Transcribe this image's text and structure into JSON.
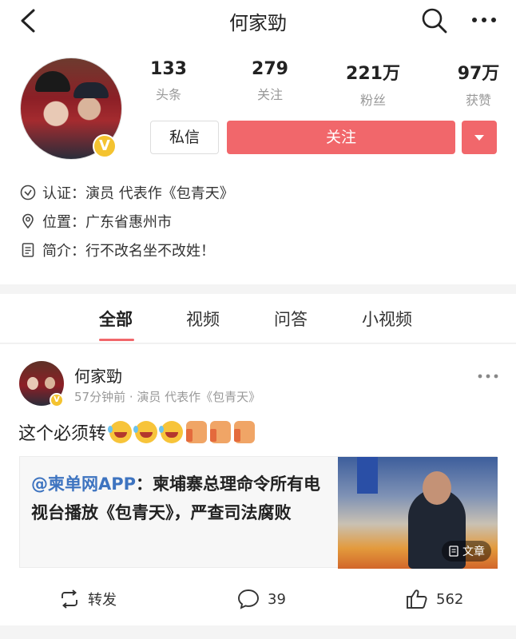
{
  "topbar": {
    "title": "何家勁"
  },
  "profile": {
    "stats": [
      {
        "value": "133",
        "label": "头条"
      },
      {
        "value": "279",
        "label": "关注"
      },
      {
        "value": "221万",
        "label": "粉丝"
      },
      {
        "value": "97万",
        "label": "获赞"
      }
    ],
    "message_label": "私信",
    "follow_label": "关注",
    "info": [
      {
        "icon": "verified-icon",
        "label": "认证：",
        "value": "演员 代表作《包青天》"
      },
      {
        "icon": "location-icon",
        "label": "位置：",
        "value": "广东省惠州市"
      },
      {
        "icon": "document-icon",
        "label": "简介：",
        "value": "行不改名坐不改姓！"
      }
    ]
  },
  "tabs": [
    "全部",
    "视频",
    "问答",
    "小视频"
  ],
  "post": {
    "author": "何家勁",
    "meta": "57分钟前 · 演员 代表作《包青天》",
    "text": "这个必须转",
    "emojis": [
      "laugh",
      "laugh",
      "laugh",
      "thumbs-up",
      "thumbs-up",
      "thumbs-up"
    ],
    "shared": {
      "source": "@柬单网APP",
      "colon": "：",
      "title": "柬埔寨总理命令所有电视台播放《包青天》，严查司法腐败",
      "badge": "文章"
    },
    "actions": {
      "repost_label": "转发",
      "comments": "39",
      "likes": "562"
    }
  },
  "colors": {
    "accent": "#f1676b",
    "link": "#3e74c0",
    "badge": "#f4c330"
  }
}
